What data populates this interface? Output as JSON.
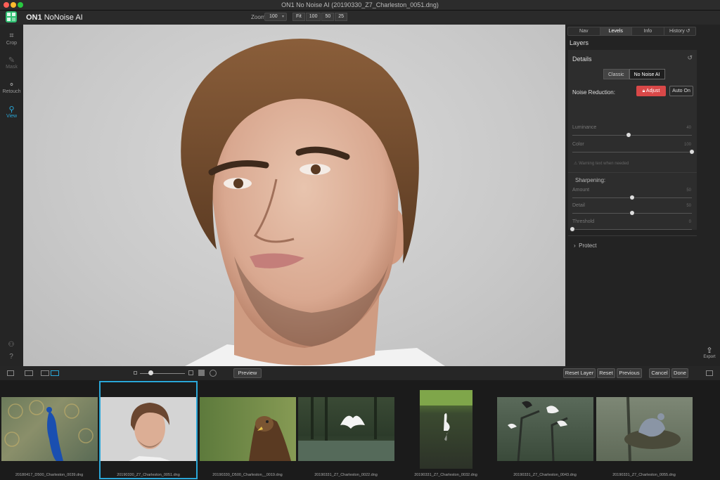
{
  "window": {
    "title": "ON1 No Noise AI (20190330_Z7_Charleston_0051.dng)"
  },
  "app": {
    "brand": "ON1",
    "product": "NoNoise AI"
  },
  "zoom": {
    "label": "Zoom",
    "value": "100",
    "buttons": [
      "Fit",
      "100",
      "50",
      "25"
    ]
  },
  "tools": [
    {
      "label": "Crop",
      "icon": "crop-icon",
      "glyph": "⌗"
    },
    {
      "label": "Mask",
      "icon": "mask-brush-icon",
      "glyph": "✎"
    },
    {
      "label": "Retouch",
      "icon": "retouch-icon",
      "glyph": "⚬"
    },
    {
      "label": "View",
      "icon": "view-magnifier-icon",
      "glyph": "⚲"
    }
  ],
  "panel": {
    "tabs": [
      "Nav",
      "Levels",
      "Info",
      "History"
    ],
    "active_tab": "Levels",
    "layers_title": "Layers",
    "details_title": "Details",
    "mode_options": [
      "Classic",
      "No Noise AI"
    ],
    "active_mode": "No Noise AI",
    "noise_reduction_label": "Noise Reduction:",
    "adjust_label": "Adjust",
    "auto_on_label": "Auto On",
    "sliders_noise": [
      {
        "label": "Luminance",
        "value": "40",
        "position": 0.47
      },
      {
        "label": "Color",
        "value": "100",
        "position": 1.0
      }
    ],
    "warning_text": "Warning text when needed",
    "sharpening_title": "Sharpening:",
    "sliders_sharpen": [
      {
        "label": "Amount",
        "value": "50",
        "position": 0.5
      },
      {
        "label": "Detail",
        "value": "50",
        "position": 0.5
      },
      {
        "label": "Threshold",
        "value": "0",
        "position": 0.0
      }
    ],
    "protect_label": "Protect"
  },
  "export_label": "Export",
  "bottom": {
    "preview_label": "Preview",
    "reset_layer_label": "Reset Layer",
    "reset_label": "Reset",
    "previous_label": "Previous",
    "cancel_label": "Cancel",
    "done_label": "Done"
  },
  "filmstrip": [
    {
      "name": "20180417_D500_Charleston_0039.dng",
      "kind": "peacock"
    },
    {
      "name": "20190330_Z7_Charleston_0051.dng",
      "kind": "portrait",
      "selected": true
    },
    {
      "name": "20190330_D500_Charleston__0019.dng",
      "kind": "eagle"
    },
    {
      "name": "20190331_Z7_Charleston_0022.dng",
      "kind": "egret-flying"
    },
    {
      "name": "20190331_Z7_Charleston_0032.dng",
      "kind": "egret-water"
    },
    {
      "name": "20190331_Z7_Charleston_0043.dng",
      "kind": "egrets-tree"
    },
    {
      "name": "20190331_Z7_Charleston_0055.dng",
      "kind": "heron"
    }
  ],
  "colors": {
    "accent": "#2aa7d8",
    "adjust": "#d94848",
    "brand": "#2fbf71"
  }
}
